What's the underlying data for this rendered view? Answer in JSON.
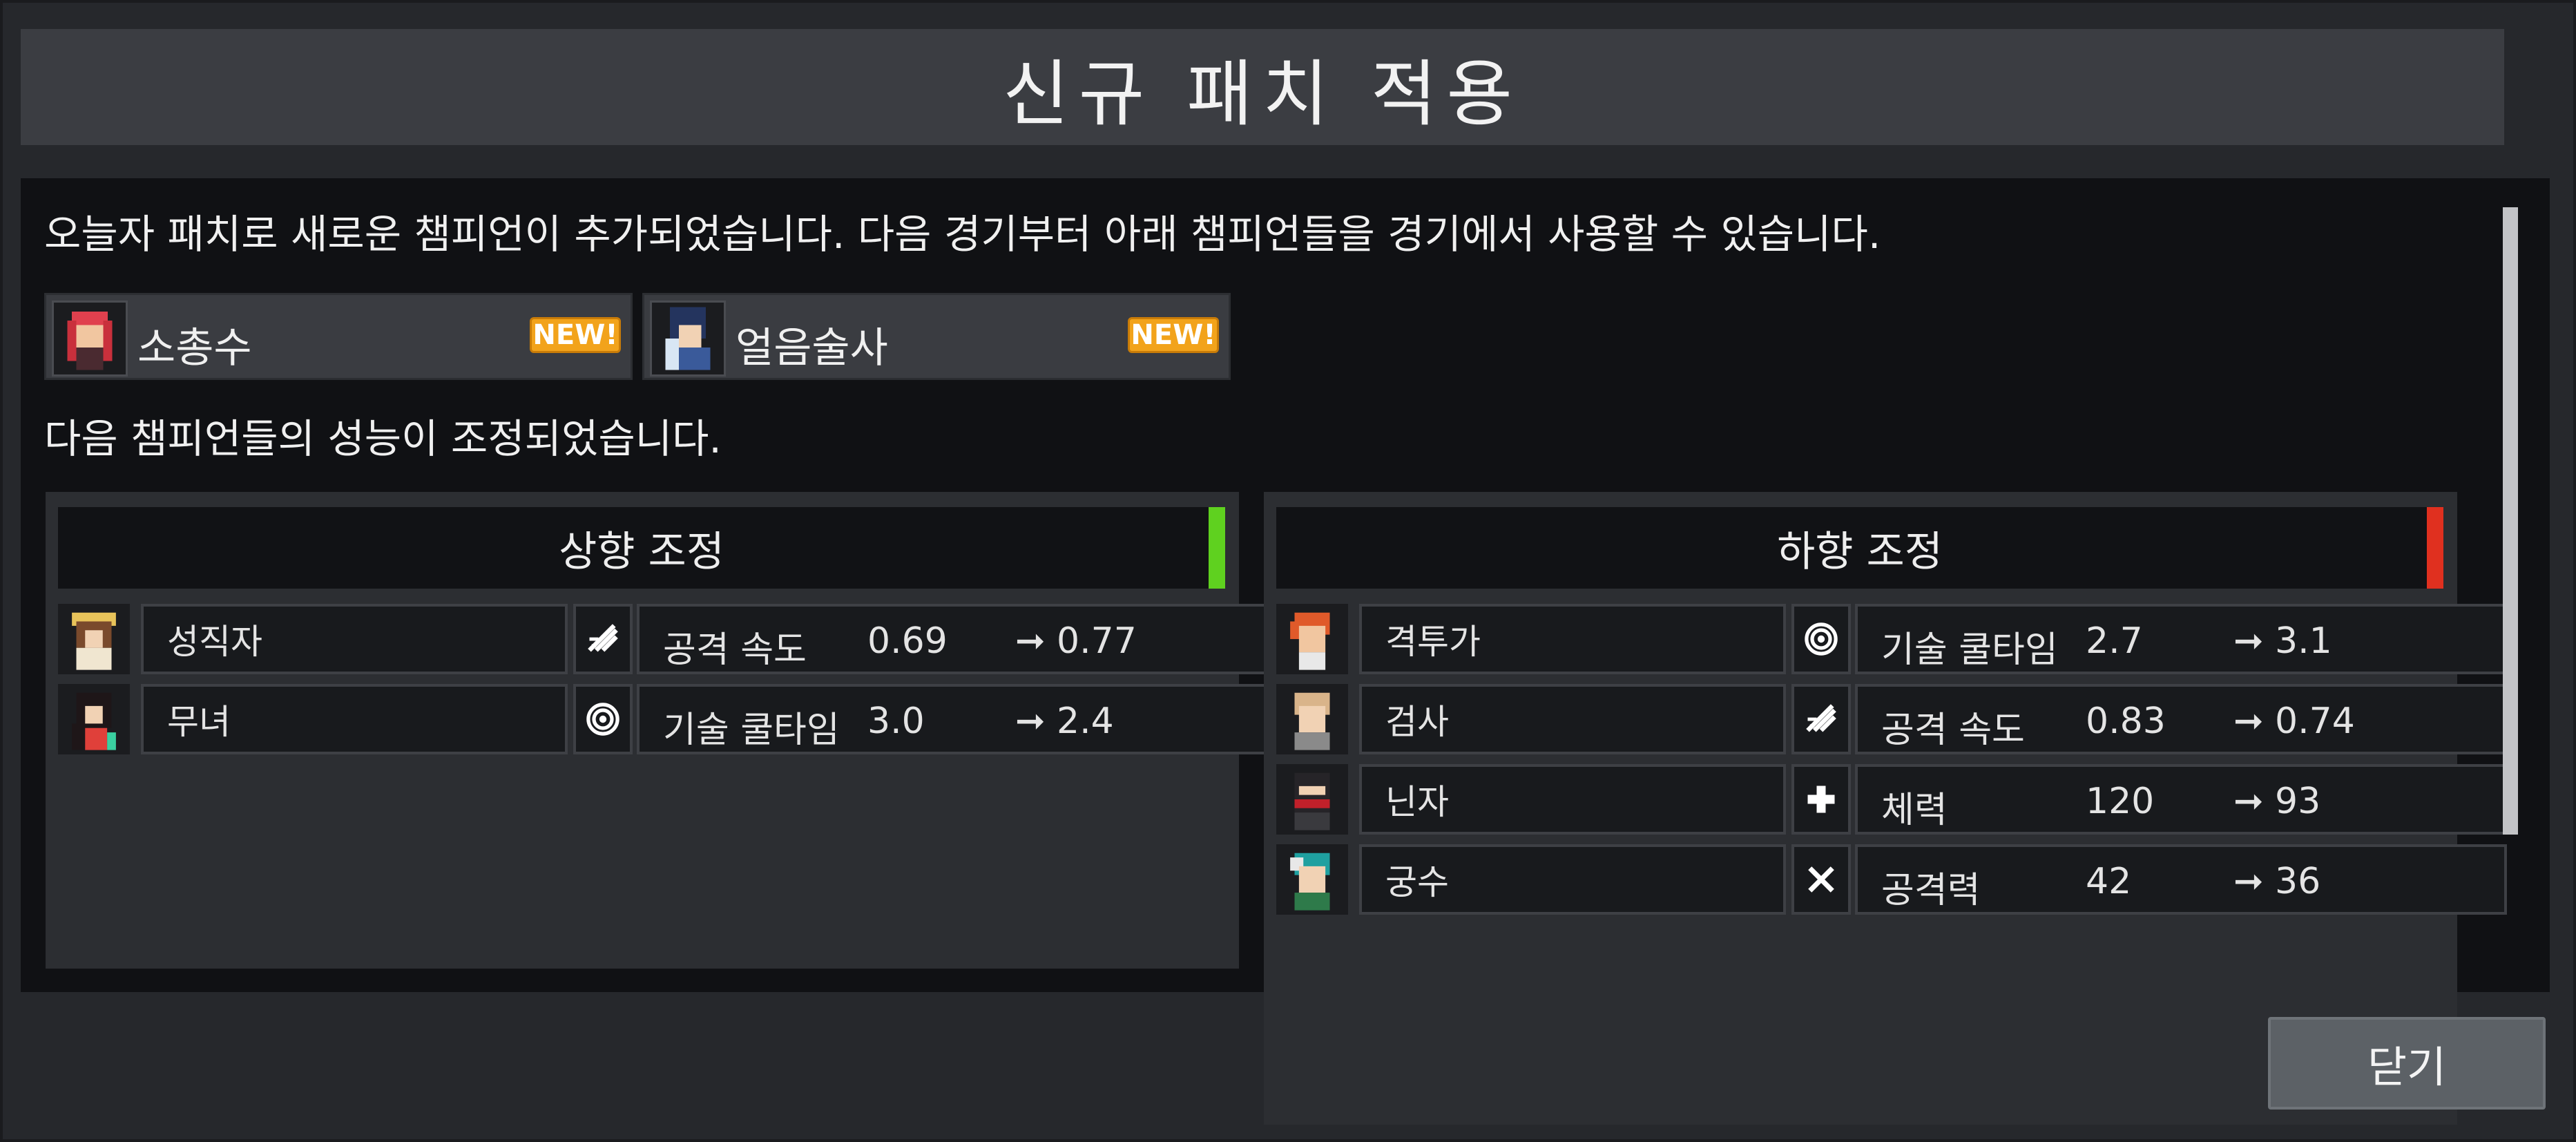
{
  "dialog": {
    "title": "신규 패치 적용",
    "intro": "오늘자 패치로 새로운 챔피언이 추가되었습니다. 다음 경기부터 아래 챔피언들을 경기에서 사용할 수 있습니다.",
    "adjust_intro": "다음 챔피언들의 성능이 조정되었습니다.",
    "close_label": "닫기"
  },
  "new_champions": [
    {
      "name": "소총수",
      "badge": "NEW!",
      "portrait_color": "#e0404e"
    },
    {
      "name": "얼음술사",
      "badge": "NEW!",
      "portrait_color": "#3a4f8a"
    }
  ],
  "buff_panel": {
    "title": "상향 조정",
    "accent_color": "#5fd11f",
    "rows": [
      {
        "name": "성직자",
        "icon": "attack-speed-icon",
        "stat": "공격 속도",
        "from": "0.69",
        "arrow": "➞",
        "to": "0.77",
        "portrait_color": "#8a5a3c"
      },
      {
        "name": "무녀",
        "icon": "cooldown-icon",
        "stat": "기술 쿨타임",
        "from": "3.0",
        "arrow": "➞",
        "to": "2.4",
        "portrait_color": "#2a1e22"
      }
    ]
  },
  "nerf_panel": {
    "title": "하향 조정",
    "accent_color": "#e0301f",
    "rows": [
      {
        "name": "격투가",
        "icon": "cooldown-icon",
        "stat": "기술 쿨타임",
        "from": "2.7",
        "arrow": "➞",
        "to": "3.1",
        "portrait_color": "#e05a2a"
      },
      {
        "name": "검사",
        "icon": "attack-speed-icon",
        "stat": "공격 속도",
        "from": "0.83",
        "arrow": "➞",
        "to": "0.74",
        "portrait_color": "#d9b48a"
      },
      {
        "name": "닌자",
        "icon": "health-icon",
        "stat": "체력",
        "from": "120",
        "arrow": "➞",
        "to": "93",
        "portrait_color": "#262428"
      },
      {
        "name": "궁수",
        "icon": "attack-power-icon",
        "stat": "공격력",
        "from": "42",
        "arrow": "➞",
        "to": "36",
        "portrait_color": "#1fa0a0"
      }
    ]
  }
}
